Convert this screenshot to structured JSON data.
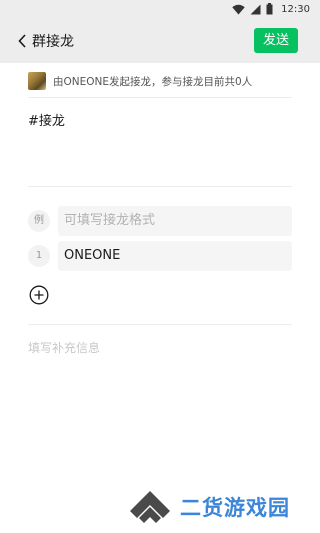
{
  "status_bar": {
    "time": "12:30"
  },
  "header": {
    "back_icon": "chevron-left-icon",
    "title": "群接龙",
    "send_label": "发送",
    "accent": "#07c160"
  },
  "initiator": {
    "text": "由ONEONE发起接龙，参与接龙目前共0人"
  },
  "topic": "#接龙",
  "entries": {
    "example": {
      "marker": "例",
      "placeholder": "可填写接龙格式"
    },
    "items": [
      {
        "number": "1",
        "value": "ONEONE"
      }
    ]
  },
  "add_icon": "plus-circle-icon",
  "supplement": {
    "placeholder": "填写补充信息"
  },
  "watermark": {
    "text": "二货游戏园",
    "color": "#3b86d8"
  }
}
